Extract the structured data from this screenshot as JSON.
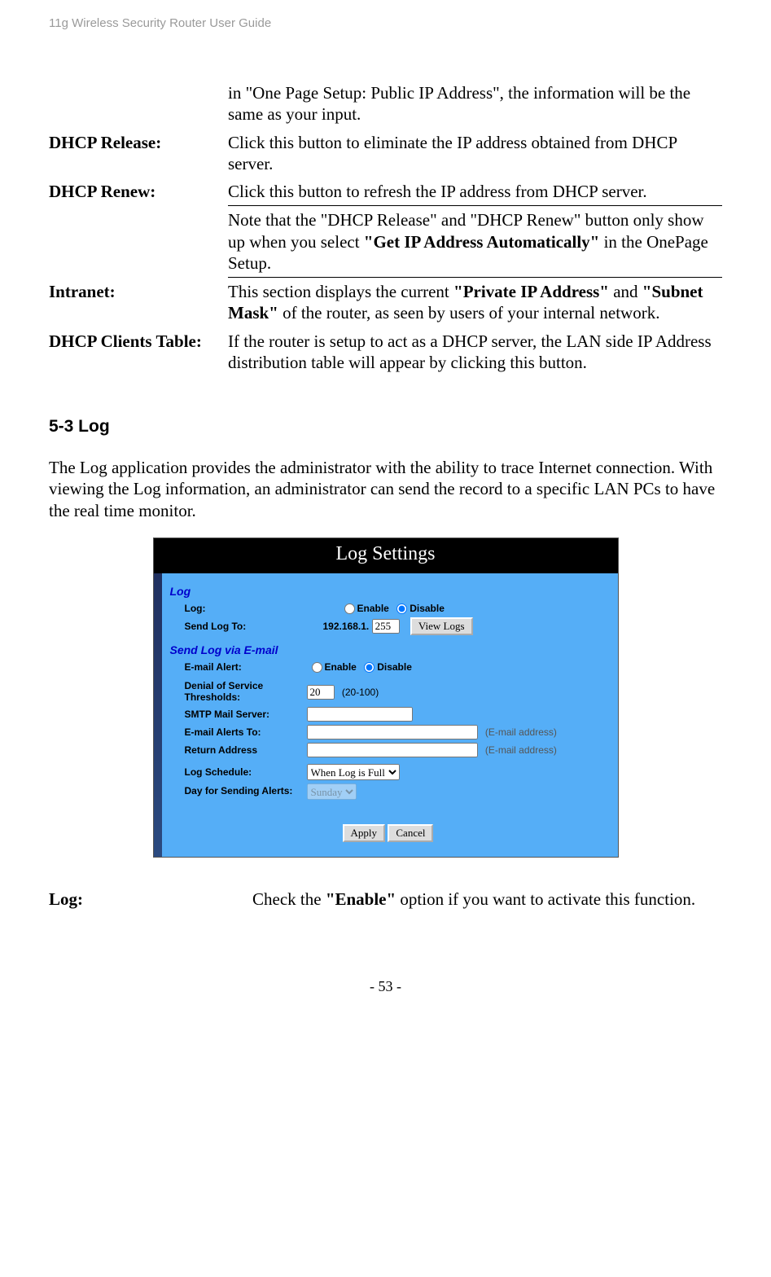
{
  "header": "11g Wireless Security Router User Guide",
  "intro_continued": "in \"One Page Setup: Public IP Address\", the information will be the same as your input.",
  "defs": {
    "dhcp_release_term": "DHCP Release:",
    "dhcp_release_desc": "Click this button to eliminate the IP address obtained from DHCP server.",
    "dhcp_renew_term": "DHCP Renew:",
    "dhcp_renew_desc": "Click this button to refresh the IP address from DHCP server.",
    "note_pre": "Note that the \"DHCP Release\" and \"DHCP Renew\" button only show up when you select ",
    "note_bold": "\"Get IP Address Automatically\"",
    "note_post": " in the OnePage Setup.",
    "intranet_term": "Intranet:",
    "intranet_pre": "This section displays the current ",
    "intranet_b1": "\"Private IP Address\"",
    "intranet_mid": " and ",
    "intranet_b2": "\"Subnet Mask\"",
    "intranet_post": " of the router, as seen by users of your internal network.",
    "clients_term": "DHCP Clients Table:",
    "clients_desc": "If the router is setup to act as a DHCP server, the LAN side IP Address distribution table will appear by clicking this button."
  },
  "section_heading": "5-3 Log",
  "section_para": "The Log application provides the administrator with the ability to trace Internet connection. With viewing the Log information, an administrator can send the record to a specific LAN PCs to have the real time monitor.",
  "shot": {
    "title": "Log Settings",
    "sec_log": "Log",
    "log_label": "Log:",
    "enable": "Enable",
    "disable": "Disable",
    "send_log_to": "Send Log To:",
    "ip_prefix": "192.168.1.",
    "ip_last": "255",
    "view_logs": "View Logs",
    "sec_email": "Send Log via E-mail",
    "email_alert": "E-mail Alert:",
    "dos_thresholds": "Denial of Service Thresholds:",
    "dos_value": "20",
    "dos_hint": "(20-100)",
    "smtp": "SMTP Mail Server:",
    "alerts_to": "E-mail Alerts To:",
    "email_hint": "(E-mail address)",
    "return_addr": "Return Address",
    "log_schedule": "Log Schedule:",
    "schedule_opt": "When Log is Full",
    "day_label": "Day for Sending Alerts:",
    "day_opt": "Sunday",
    "apply": "Apply",
    "cancel": "Cancel"
  },
  "post": {
    "log_term": "Log:",
    "log_pre": "Check the ",
    "log_bold": "\"Enable\"",
    "log_post": " option if you want to activate this function."
  },
  "footer": "- 53 -"
}
